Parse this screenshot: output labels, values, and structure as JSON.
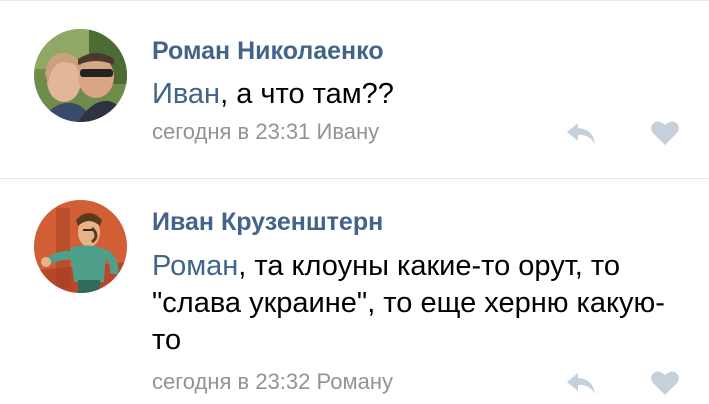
{
  "comments": [
    {
      "author": "Роман Николаенко",
      "mention": "Иван",
      "text": ", а что там??",
      "time": "сегодня в 23:31",
      "reply_to": "Ивану",
      "avatar_icon": "couple-photo-avatar"
    },
    {
      "author": "Иван Крузенштерн",
      "mention": "Роман",
      "text": ", та клоуны какие-то орут, то \"слава украине\", то еще херню какую-то",
      "time": "сегодня в 23:32",
      "reply_to": "Роману",
      "avatar_icon": "cartoon-character-avatar"
    }
  ],
  "icons": {
    "reply": "reply-arrow-icon",
    "like": "heart-icon"
  },
  "colors": {
    "link": "#42648b",
    "meta": "#939393",
    "icon": "#c5d0db",
    "divider": "#e7e8ec"
  }
}
